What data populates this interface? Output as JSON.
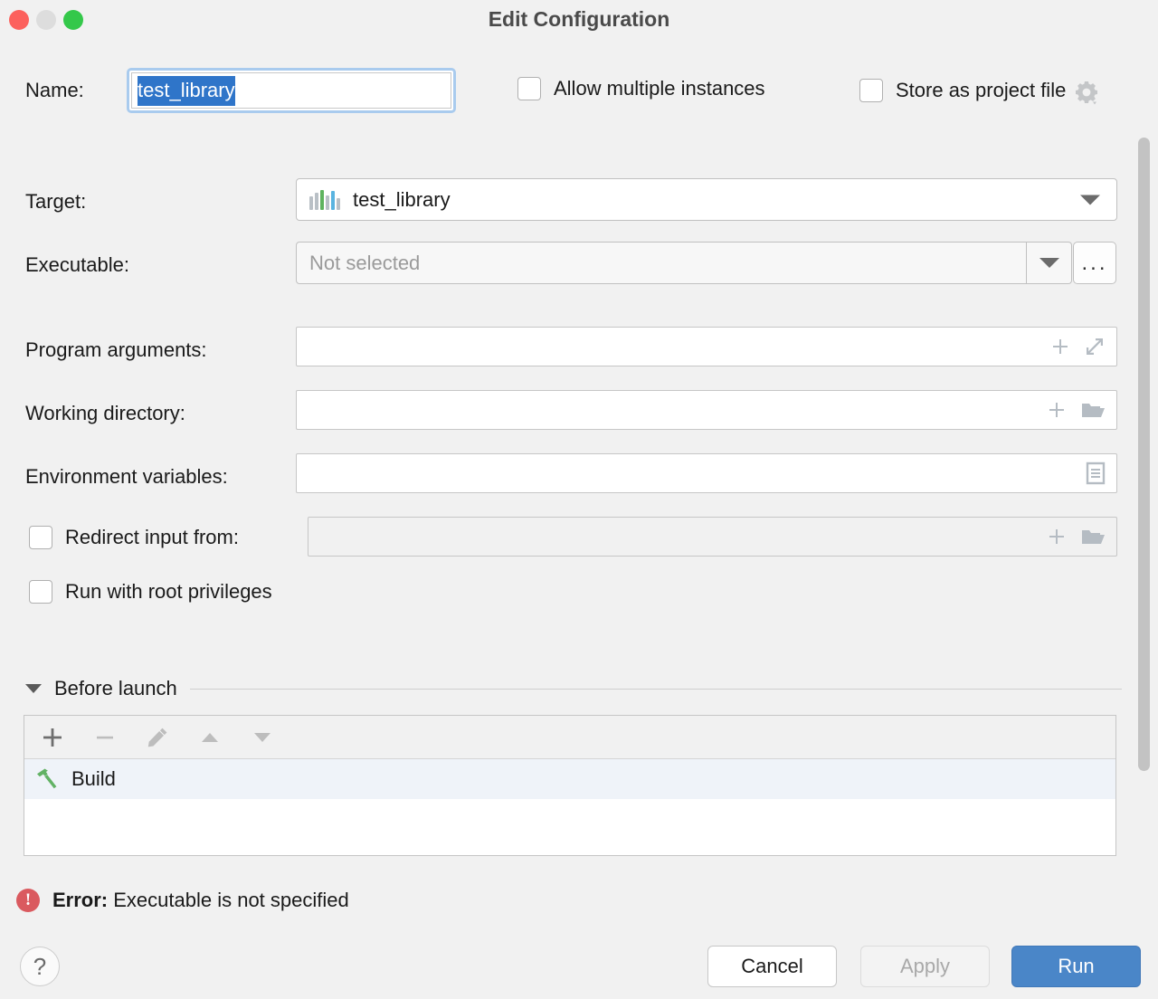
{
  "window": {
    "title": "Edit Configuration",
    "traffic_lights": [
      "close-red",
      "minimize-gray",
      "zoom-green"
    ]
  },
  "name_row": {
    "label": "Name:",
    "value": "test_library",
    "selected": true
  },
  "header_options": [
    {
      "label": "Allow multiple instances",
      "checked": false
    },
    {
      "label": "Store as project file",
      "checked": false,
      "gear": "gear-icon"
    }
  ],
  "fields": {
    "target": {
      "label": "Target:",
      "value": "test_library",
      "icon": "library-icon",
      "type": "combo"
    },
    "executable": {
      "label": "Executable:",
      "value": "",
      "placeholder": "Not selected",
      "type": "combo",
      "disabled": true,
      "browse_label": "..."
    },
    "program_arguments": {
      "label": "Program arguments:",
      "value": "",
      "icons": [
        "plus-icon",
        "expand-icon"
      ]
    },
    "working_directory": {
      "label": "Working directory:",
      "value": "",
      "icons": [
        "plus-icon",
        "folder-icon"
      ]
    },
    "environment_variables": {
      "label": "Environment variables:",
      "value": "",
      "icons": [
        "list-icon"
      ]
    },
    "redirect_input": {
      "label": "Redirect input from:",
      "checked": false,
      "value": "",
      "disabled": true,
      "icons": [
        "plus-icon",
        "folder-icon"
      ]
    },
    "run_root": {
      "label": "Run with root privileges",
      "checked": false
    }
  },
  "before_launch": {
    "title": "Before launch",
    "toolbar": [
      "add-icon",
      "remove-icon",
      "edit-icon",
      "move-up-icon",
      "move-down-icon"
    ],
    "items": [
      {
        "label": "Build",
        "icon": "hammer-icon",
        "selected": true
      }
    ]
  },
  "status": {
    "prefix": "Error:",
    "message": "Executable is not specified"
  },
  "footer": {
    "help_label": "?",
    "cancel_label": "Cancel",
    "apply_label": "Apply",
    "run_label": "Run"
  },
  "colors": {
    "accent": "#4a86c8",
    "selection": "#2f75c9",
    "focus_ring": "#a9cbee",
    "error": "#da5a5f",
    "hammer": "#62b265"
  }
}
